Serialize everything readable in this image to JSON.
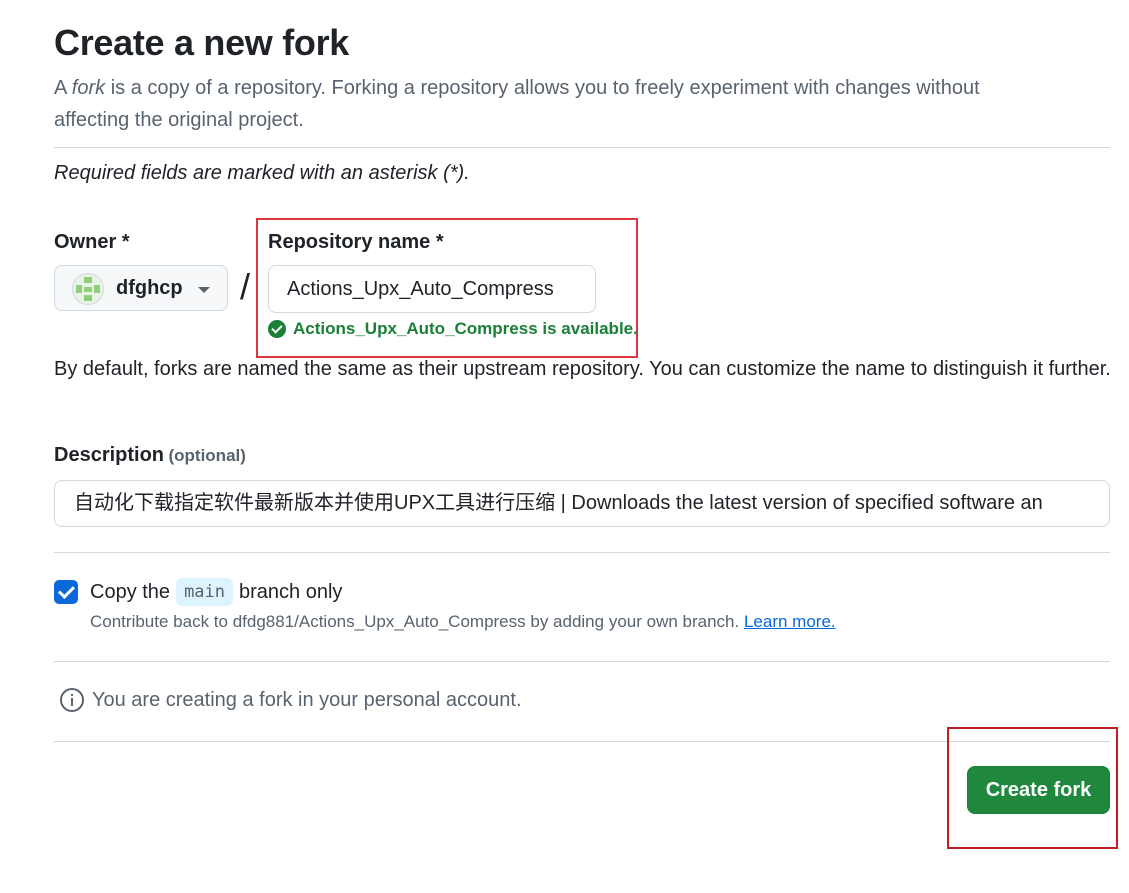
{
  "header": {
    "title": "Create a new fork",
    "lead_prefix": "A ",
    "lead_em": "fork",
    "lead_rest": " is a copy of a repository. Forking a repository allows you to freely experiment with changes without affecting the original project."
  },
  "required_note": "Required fields are marked with an asterisk (*).",
  "owner": {
    "label": "Owner *",
    "value": "dfghcp"
  },
  "separator": "/",
  "repository": {
    "label": "Repository name *",
    "value": "Actions_Upx_Auto_Compress",
    "availability": "Actions_Upx_Auto_Compress is available."
  },
  "naming_note": "By default, forks are named the same as their upstream repository. You can customize the name to distinguish it further.",
  "description": {
    "label": "Description",
    "optional": "(optional)",
    "value": "自动化下载指定软件最新版本并使用UPX工具进行压缩 | Downloads the latest version of specified software an"
  },
  "copy_branch": {
    "checked": true,
    "label_before": "Copy the",
    "branch": "main",
    "label_after": "branch only",
    "sub_text": "Contribute back to dfdg881/Actions_Upx_Auto_Compress by adding your own branch.",
    "learn_more": "Learn more."
  },
  "info": "You are creating a fork in your personal account.",
  "actions": {
    "create_fork": "Create fork"
  },
  "colors": {
    "primary_button": "#1f883d",
    "success_text": "#1a7f37",
    "checkbox": "#0969da",
    "highlight_box": "#d9363e"
  }
}
